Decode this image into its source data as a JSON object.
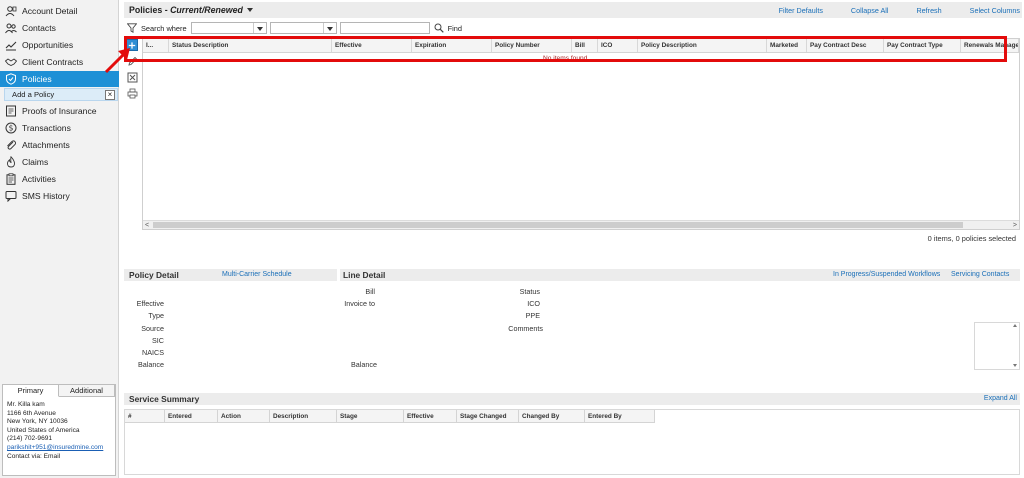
{
  "sidebar": {
    "items": [
      {
        "label": "Account Detail",
        "icon": "account-detail-icon"
      },
      {
        "label": "Contacts",
        "icon": "contacts-icon"
      },
      {
        "label": "Opportunities",
        "icon": "opportunities-icon"
      },
      {
        "label": "Client Contracts",
        "icon": "handshake-icon"
      },
      {
        "label": "Policies",
        "icon": "shield-icon"
      },
      {
        "label": "Proofs of Insurance",
        "icon": "certificate-icon"
      },
      {
        "label": "Transactions",
        "icon": "dollar-icon"
      },
      {
        "label": "Attachments",
        "icon": "paperclip-icon"
      },
      {
        "label": "Claims",
        "icon": "flame-icon"
      },
      {
        "label": "Activities",
        "icon": "clipboard-icon"
      },
      {
        "label": "SMS History",
        "icon": "chat-icon"
      }
    ],
    "sub_item": {
      "label": "Add a Policy",
      "close": "×"
    }
  },
  "contact": {
    "tabs": [
      "Primary",
      "Additional"
    ],
    "name": "Mr. Killa kam",
    "address1": "1166 6th Avenue",
    "address2": "New York, NY  10036",
    "country": "United States of America",
    "phone": "(214) 702-9691",
    "email": "parikshit+951@insuredmine.com",
    "contact_via": "Contact via: Email"
  },
  "header": {
    "title_prefix": "Policies - ",
    "title_view": "Current/Renewed",
    "links": [
      "Filter Defaults",
      "Collapse All",
      "Refresh",
      "Select Columns"
    ]
  },
  "search": {
    "label": "Search where",
    "find_label": "Find"
  },
  "grid": {
    "columns": [
      "I...",
      "Status Description",
      "Effective",
      "Expiration",
      "Policy Number",
      "Bill",
      "ICO",
      "Policy Description",
      "Marketed",
      "Pay Contract Desc",
      "Pay Contract Type",
      "Renewals Manager"
    ],
    "empty_text": "No items found",
    "count_text": "0 items, 0 policies selected",
    "scroll_left": "<",
    "scroll_right": ">"
  },
  "policy_detail": {
    "title": "Policy Detail",
    "link": "Multi-Carrier Schedule",
    "fields": [
      "Effective",
      "Type",
      "Source",
      "SIC",
      "NAICS",
      "Balance"
    ]
  },
  "line_detail": {
    "title": "Line Detail",
    "links": [
      "In Progress/Suspended Workflows",
      "Servicing Contacts"
    ],
    "left_fields": [
      "Bill",
      "Invoice to"
    ],
    "balance_label": "Balance",
    "right_fields": [
      "Status",
      "ICO",
      "PPE",
      "Comments"
    ]
  },
  "service_summary": {
    "title": "Service Summary",
    "link": "Expand All",
    "columns": [
      "#",
      "Entered",
      "Action",
      "Description",
      "Stage",
      "Effective",
      "Stage Changed",
      "Changed By",
      "Entered By"
    ]
  },
  "colors": {
    "accent": "#1e90d6",
    "highlight": "#e30b0b",
    "link": "#1a6fb8"
  }
}
